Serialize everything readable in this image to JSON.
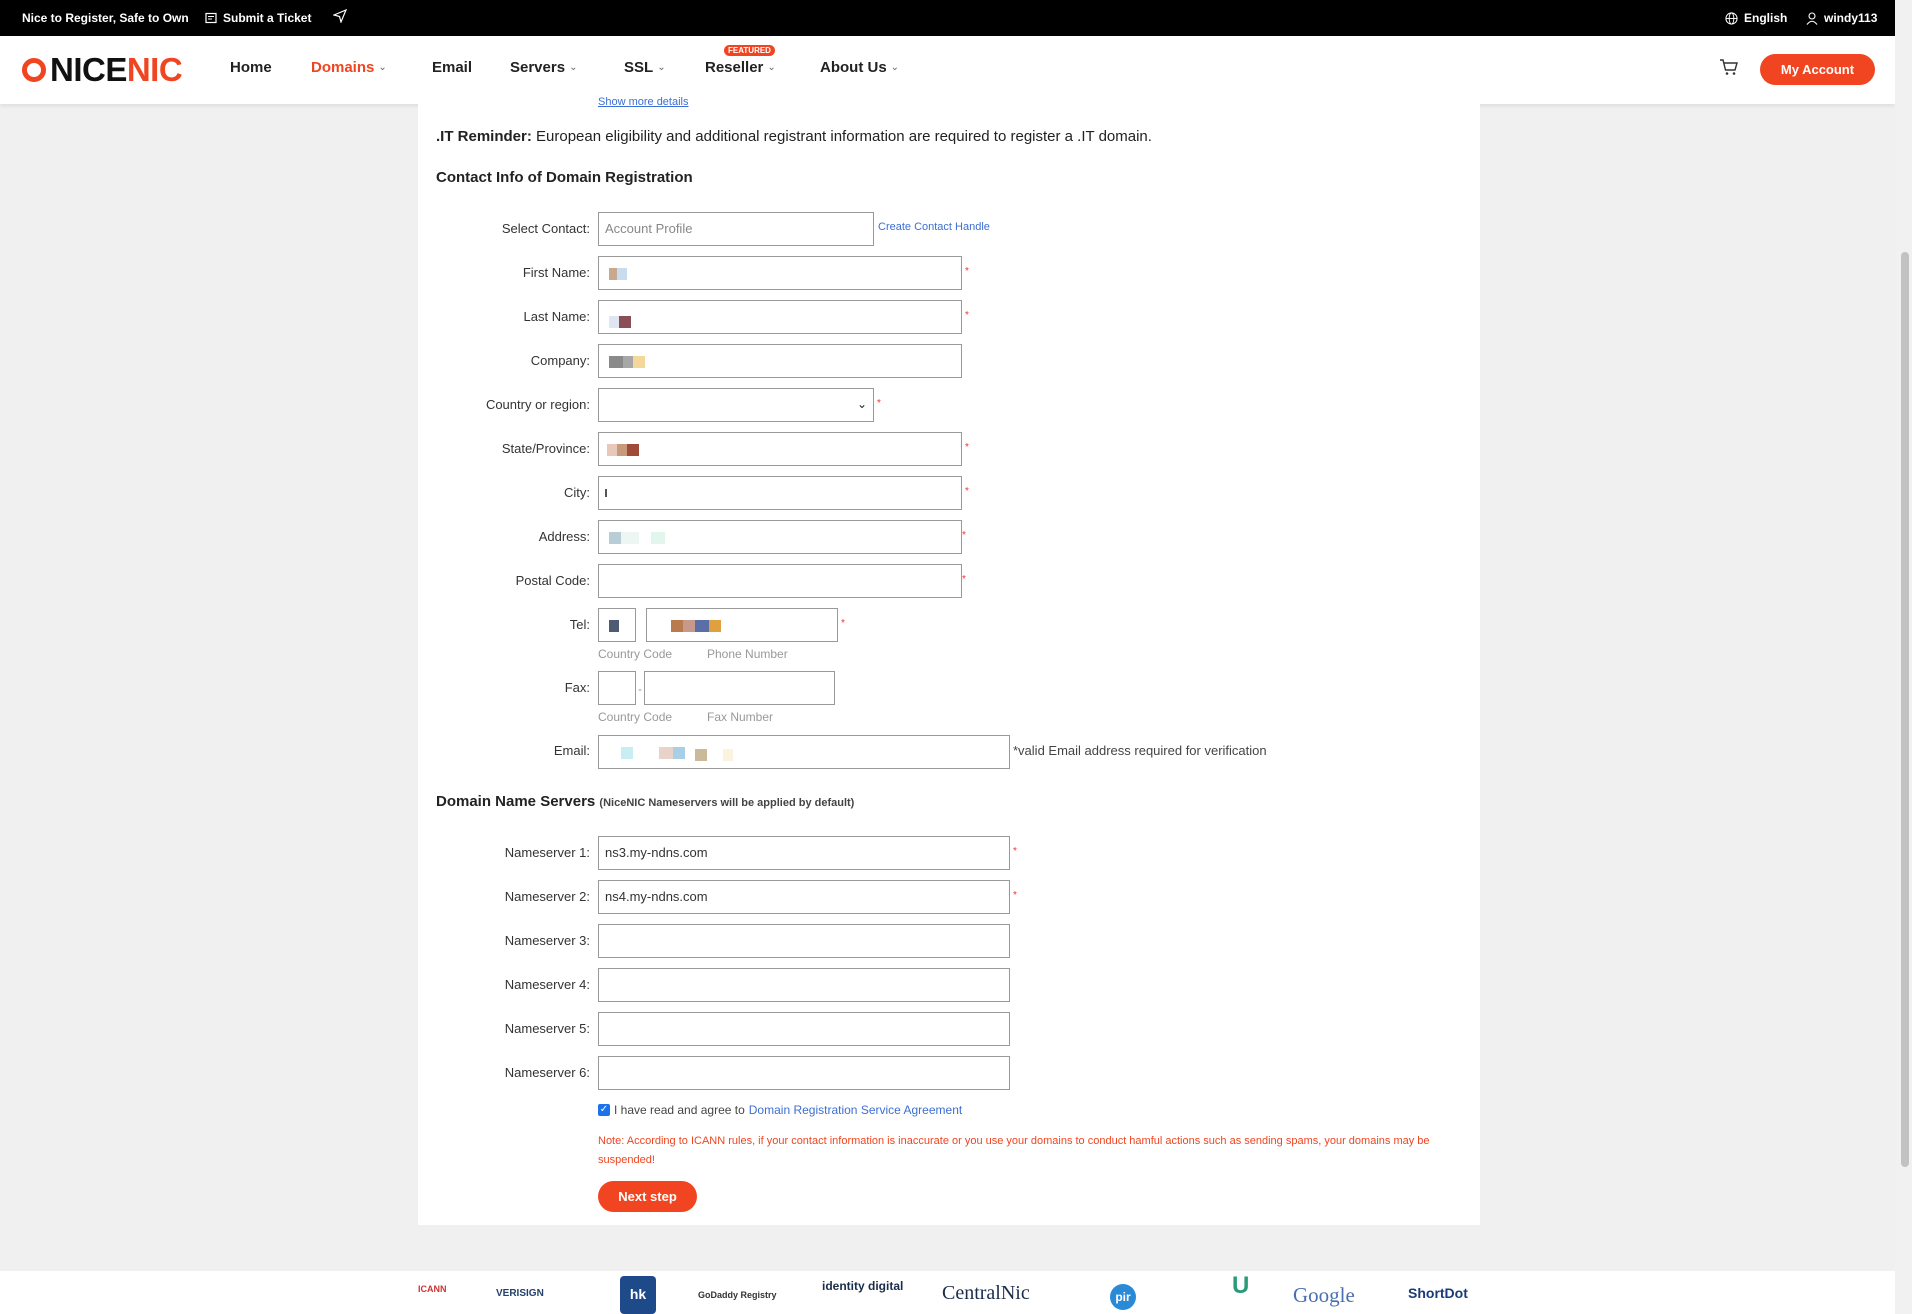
{
  "topbar": {
    "slogan": "Nice to Register, Safe to Own",
    "ticket": "Submit a Ticket",
    "language": "English",
    "username": "windy113"
  },
  "header": {
    "logo_part1": "NICE",
    "logo_part2": "NIC",
    "nav": {
      "home": "Home",
      "domains": "Domains",
      "email": "Email",
      "servers": "Servers",
      "ssl": "SSL",
      "reseller": "Reseller",
      "about": "About Us"
    },
    "featured_badge": "FEATURED",
    "my_account": "My Account"
  },
  "form": {
    "show_more": "Show more details",
    "reminder_bold": ".IT Reminder:",
    "reminder_text": " European eligibility and additional registrant information are required to register a .IT domain.",
    "contact_title": "Contact Info of Domain Registration",
    "labels": {
      "select_contact": "Select Contact:",
      "first_name": "First Name:",
      "last_name": "Last Name:",
      "company": "Company:",
      "country": "Country or region:",
      "state": "State/Province:",
      "city": "City:",
      "address": "Address:",
      "postal": "Postal Code:",
      "tel": "Tel:",
      "fax": "Fax:",
      "email": "Email:"
    },
    "select_contact_placeholder": "Account Profile",
    "create_contact_handle": "Create Contact Handle",
    "tel_hint_code": "Country Code",
    "tel_hint_number": "Phone Number",
    "fax_hint_code": "Country Code",
    "fax_hint_number": "Fax Number",
    "fax_separator": "-",
    "email_note": "*valid Email address required for verification",
    "ns_title": "Domain Name Servers",
    "ns_subtitle": "(NiceNIC Nameservers will be applied by default)",
    "nameservers": [
      {
        "label": "Nameserver 1:",
        "value": "ns3.my-ndns.com"
      },
      {
        "label": "Nameserver 2:",
        "value": "ns4.my-ndns.com"
      },
      {
        "label": "Nameserver 3:",
        "value": ""
      },
      {
        "label": "Nameserver 4:",
        "value": ""
      },
      {
        "label": "Nameserver 5:",
        "value": ""
      },
      {
        "label": "Nameserver 6:",
        "value": ""
      }
    ],
    "agree_checked": true,
    "agree_text": "I have read and agree to",
    "agree_link": "Domain Registration Service Agreement",
    "warning": "Note: According to ICANN rules, if your contact information is inaccurate or you use your domains to conduct hamful actions such as sending spams, your domains may be suspended!",
    "next_button": "Next step"
  },
  "footer_logos": [
    "ICANN",
    "VERISIGN",
    "hk",
    "GoDaddy Registry",
    "identity digital",
    "CentralNic",
    "pir",
    "U",
    "Google",
    "ShortDot"
  ],
  "colors": {
    "brand": "#f04520",
    "link": "#3b6fd3"
  }
}
